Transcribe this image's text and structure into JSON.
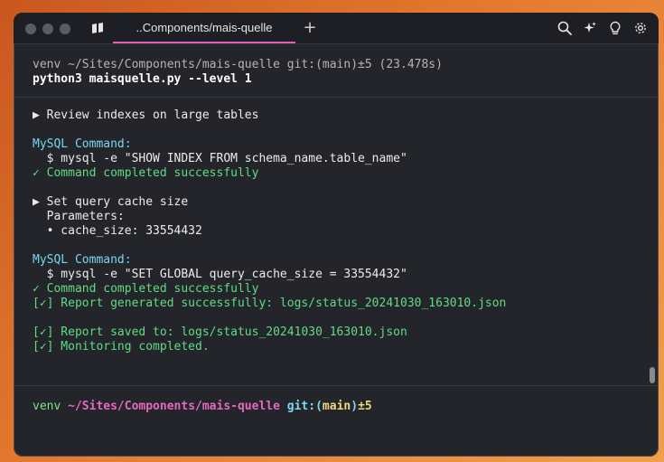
{
  "window": {
    "tab_title": "..Components/mais-quelle",
    "new_tab_symbol": "+",
    "toolbar_icons": [
      "search-icon",
      "sparkles-icon",
      "lightbulb-icon",
      "gear-icon"
    ]
  },
  "block": {
    "header": "venv ~/Sites/Components/mais-quelle git:(main)±5 (23.478s)",
    "command": "python3 maisquelle.py --level 1"
  },
  "output": [
    {
      "text": "▶ Review indexes on large tables",
      "style": "white"
    },
    {
      "text": "MySQL Command:",
      "style": "cyan"
    },
    {
      "text": "  $ mysql -e \"SHOW INDEX FROM schema_name.table_name\"",
      "style": "white"
    },
    {
      "text": "✓ Command completed successfully",
      "style": "green"
    },
    {
      "text": "▶ Set query cache size",
      "style": "white"
    },
    {
      "text": "  Parameters:",
      "style": "white"
    },
    {
      "text": "  • cache_size: 33554432",
      "style": "white"
    },
    {
      "text": "MySQL Command:",
      "style": "cyan"
    },
    {
      "text": "  $ mysql -e \"SET GLOBAL query_cache_size = 33554432\"",
      "style": "white"
    },
    {
      "text": "✓ Command completed successfully",
      "style": "green"
    },
    {
      "text": "[✓] Report generated successfully: logs/status_20241030_163010.json",
      "style": "green"
    },
    {
      "text": "[✓] Report saved to: logs/status_20241030_163010.json",
      "style": "green"
    },
    {
      "text": "[✓] Monitoring completed.",
      "style": "green"
    }
  ],
  "prompt": {
    "env": "venv",
    "path": "~/Sites/Components/mais-quelle",
    "git_prefix": "git:(",
    "branch": "main",
    "git_suffix": ")",
    "changes": "±5"
  }
}
